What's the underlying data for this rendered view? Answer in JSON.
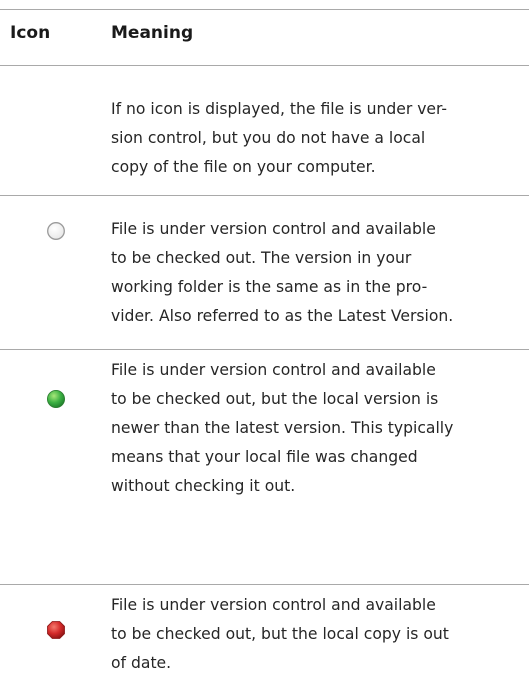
{
  "table": {
    "headers": {
      "icon": "Icon",
      "meaning": "Meaning"
    },
    "rows": [
      {
        "icon": "none",
        "lines": [
          "If no icon is displayed, the file is under ver-",
          "sion control, but you do not have a local",
          "copy of the file on your computer."
        ]
      },
      {
        "icon": "hollow-circle-icon",
        "icon_color": "#ffffff",
        "lines": [
          "File is under version control and available",
          "to be checked out. The version in your",
          "working folder is the same as in the pro-",
          "vider. Also referred to as the Latest Version."
        ]
      },
      {
        "icon": "green-circle-icon",
        "icon_color": "#3cb043",
        "lines": [
          "File is under version control and available",
          "to be checked out, but the local version is",
          "newer than the latest version. This typically",
          "means that your local file was changed",
          "without checking it out."
        ]
      },
      {
        "icon": "red-octagon-icon",
        "icon_color": "#d42a2a",
        "lines": [
          "File is under version control and available",
          "to be checked out, but the local copy is out",
          "of date."
        ]
      }
    ]
  }
}
